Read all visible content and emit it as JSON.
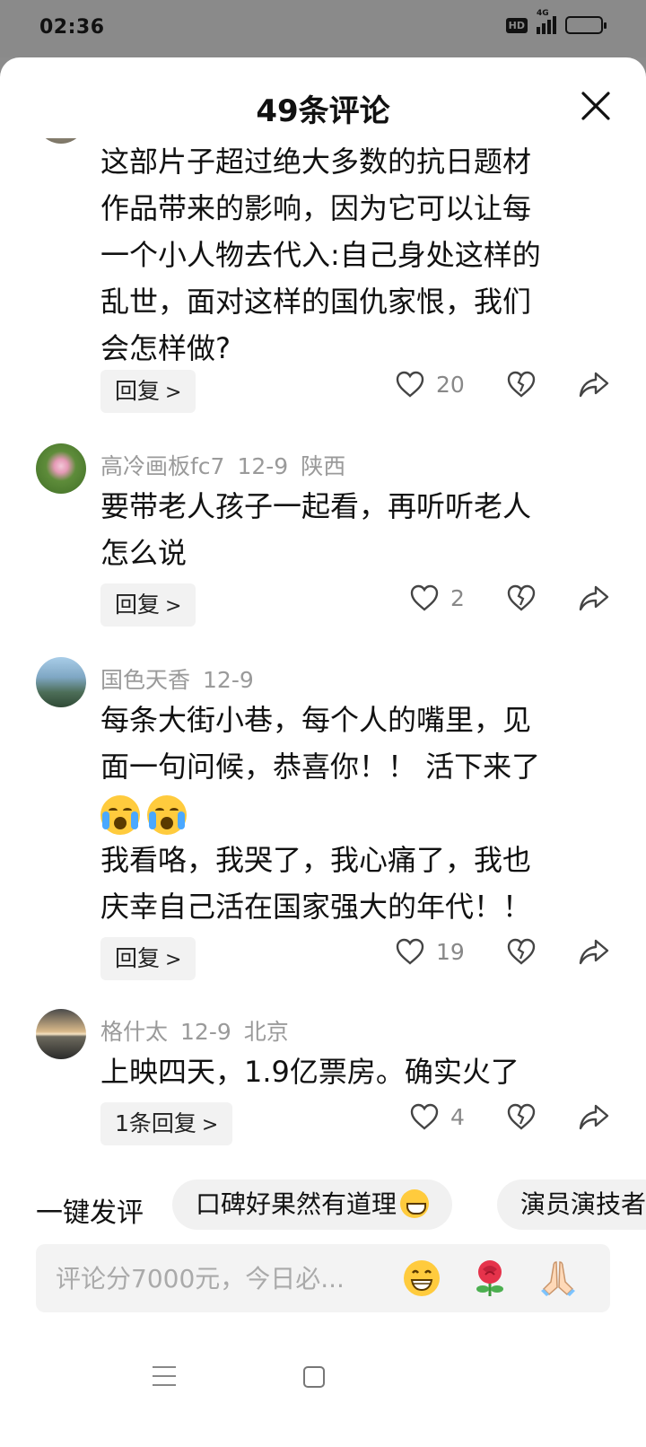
{
  "status_bar": {
    "time": "02:36",
    "hd": "HD",
    "network": "4G"
  },
  "sheet": {
    "title": "49条评论"
  },
  "comments": [
    {
      "user": "",
      "date": "",
      "location": "",
      "lines": [
        "这部片子超过绝大多数的抗日题材",
        "作品带来的影响，因为它可以让每",
        "一个小人物去代入:自己身处这样的",
        "乱世，面对这样的国仇家恨，我们",
        "会怎样做?"
      ],
      "reply_label": "回复",
      "likes": "20"
    },
    {
      "user": "高冷画板fc7",
      "date": "12-9",
      "location": "陕西",
      "lines": [
        "要带老人孩子一起看，再听听老人",
        "怎么说"
      ],
      "reply_label": "回复",
      "likes": "2"
    },
    {
      "user": "国色天香",
      "date": "12-9",
      "location": "",
      "lines": [
        "每条大街小巷，每个人的嘴里，见",
        "面一句问候，恭喜你！！ 活下来了",
        "",
        "我看咯，我哭了，我心痛了，我也",
        "庆幸自己活在国家强大的年代！！"
      ],
      "reply_label": "回复",
      "likes": "19"
    },
    {
      "user": "格什太",
      "date": "12-9",
      "location": "北京",
      "lines": [
        "上映四天，1.9亿票房。确实火了"
      ],
      "reply_label": "1条回复",
      "likes": "4"
    }
  ],
  "quick_comment": {
    "label": "一键发评",
    "chips": [
      "口碑好果然有道理",
      "演员演技者"
    ]
  },
  "input": {
    "placeholder": "评论分7000元，今日必..."
  },
  "icons": {
    "like": "heart-outline-icon",
    "dislike": "broken-heart-icon",
    "share": "share-arrow-icon",
    "close": "close-icon"
  }
}
